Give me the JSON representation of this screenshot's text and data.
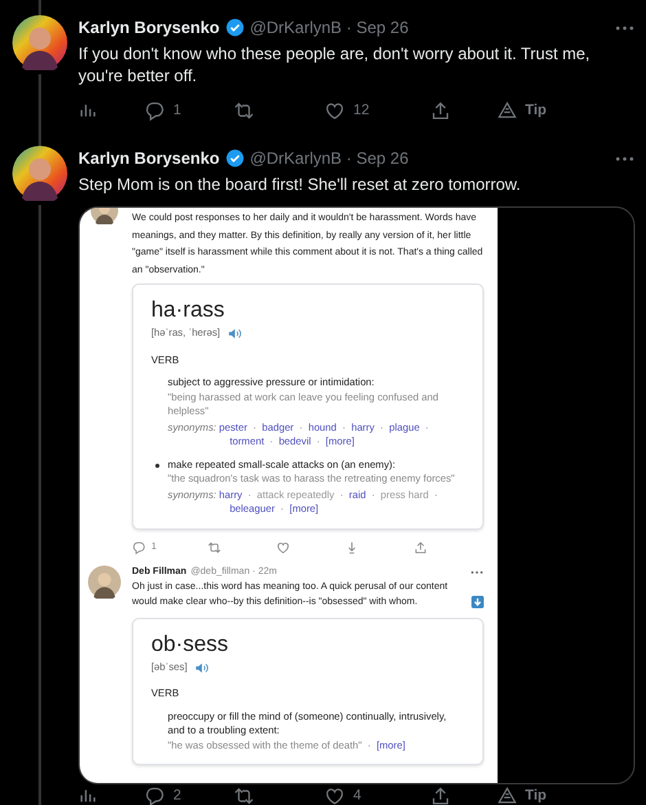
{
  "tweets": [
    {
      "author": "Karlyn Borysenko",
      "verified": true,
      "meta": "@DrKarlynB · Sep 26",
      "text": "If you don't know who these people are, don't worry about it. Trust me, you're better off.",
      "actions": {
        "replies": "1",
        "likes": "12",
        "tip": "Tip"
      }
    },
    {
      "author": "Karlyn Borysenko",
      "verified": true,
      "meta": "@DrKarlynB · Sep 26",
      "text": "Step Mom is on the board first! She'll reset at zero tomorrow.",
      "media": {
        "kind": "screenshot",
        "post": {
          "text": "We could post responses to her daily and it wouldn't be harassment. Words have meanings, and they matter. By this definition, by really any version of it, her little \"game\" itself is harassment while this comment about it is not. That's a thing called an \"observation.\"",
          "definition": {
            "word": "ha·rass",
            "pronunciation": "[həˈras, ˈherəs]",
            "part_of_speech": "VERB",
            "separator": "·",
            "senses": [
              {
                "bullet": false,
                "definition": "subject to aggressive pressure or intimidation:",
                "example": "\"being harassed at work can leave you feeling confused and helpless\"",
                "synonyms_label": "synonyms:",
                "synonyms": [
                  {
                    "text": "pester",
                    "link": true
                  },
                  {
                    "text": "badger",
                    "link": true
                  },
                  {
                    "text": "hound",
                    "link": true
                  },
                  {
                    "text": "harry",
                    "link": true
                  },
                  {
                    "text": "plague",
                    "link": true
                  },
                  {
                    "text": "torment",
                    "link": true
                  },
                  {
                    "text": "bedevil",
                    "link": true
                  },
                  {
                    "text": "[more]",
                    "link": true
                  }
                ]
              },
              {
                "bullet": true,
                "definition": "make repeated small-scale attacks on (an enemy):",
                "example": "\"the squadron's task was to harass the retreating enemy forces\"",
                "synonyms_label": "synonyms:",
                "synonyms": [
                  {
                    "text": "harry",
                    "link": true
                  },
                  {
                    "text": "attack repeatedly",
                    "link": false
                  },
                  {
                    "text": "raid",
                    "link": true
                  },
                  {
                    "text": "press hard",
                    "link": false
                  },
                  {
                    "text": "beleaguer",
                    "link": true
                  },
                  {
                    "text": "[more]",
                    "link": true
                  }
                ]
              }
            ]
          },
          "actions": {
            "replies": "1"
          }
        },
        "reply": {
          "author": "Deb Fillman",
          "meta": "@deb_fillman · 22m",
          "text": "Oh just in case...this word has meaning too. A quick perusal of our content would make clear who--by this definition--is \"obsessed\" with whom.",
          "definition": {
            "word": "ob·sess",
            "pronunciation": "[əbˈses]",
            "part_of_speech": "VERB",
            "separator": "·",
            "senses": [
              {
                "bullet": false,
                "definition": "preoccupy or fill the mind of (someone) continually, intrusively, and to a troubling extent:",
                "example": "\"he was obsessed with the theme of death\"",
                "more": "[more]"
              }
            ]
          }
        }
      },
      "actions": {
        "replies": "2",
        "likes": "4",
        "tip": "Tip"
      }
    }
  ]
}
